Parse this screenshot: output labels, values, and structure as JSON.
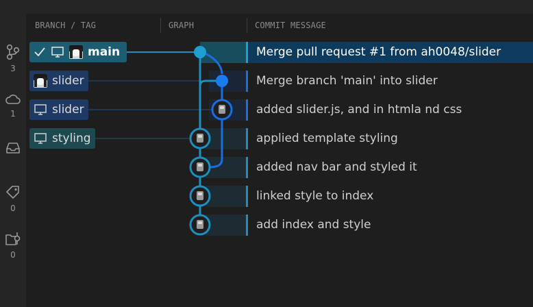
{
  "columns": {
    "branch_tag": "BRANCH / TAG",
    "graph": "GRAPH",
    "commit_message": "COMMIT MESSAGE"
  },
  "sidebar": {
    "items": [
      {
        "icon": "branch-icon",
        "count": "3"
      },
      {
        "icon": "cloud-icon",
        "count": "1"
      },
      {
        "icon": "inbox-stash-icon",
        "count": "0"
      },
      {
        "icon": "tag-icon",
        "count": "0"
      },
      {
        "icon": "worktree-icon",
        "count": "0"
      }
    ]
  },
  "refs": [
    {
      "label": "main",
      "type": "local-current",
      "icons": [
        "check-icon",
        "monitor-icon",
        "avatar"
      ]
    },
    {
      "label": "slider",
      "type": "remote",
      "icons": [
        "avatar"
      ]
    },
    {
      "label": "slider",
      "type": "local",
      "icons": [
        "monitor-icon"
      ]
    },
    {
      "label": "styling",
      "type": "local",
      "icons": [
        "monitor-icon"
      ]
    }
  ],
  "commits": [
    {
      "message": "Merge pull request #1 from ah0048/slider"
    },
    {
      "message": "Merge branch 'main' into slider"
    },
    {
      "message": "added slider.js, and in htmla nd css"
    },
    {
      "message": "applied template styling"
    },
    {
      "message": "added nav bar and styled it"
    },
    {
      "message": "linked style to index"
    },
    {
      "message": "add index and style"
    }
  ],
  "colors": {
    "lane_main": "#1f8fc1",
    "lane_slider": "#1a6fe0",
    "selected_row": "#0d3b5e",
    "main_pill": "#1d5d72",
    "slider_pill": "#1e3a64",
    "styling_pill": "#1c4a50"
  }
}
